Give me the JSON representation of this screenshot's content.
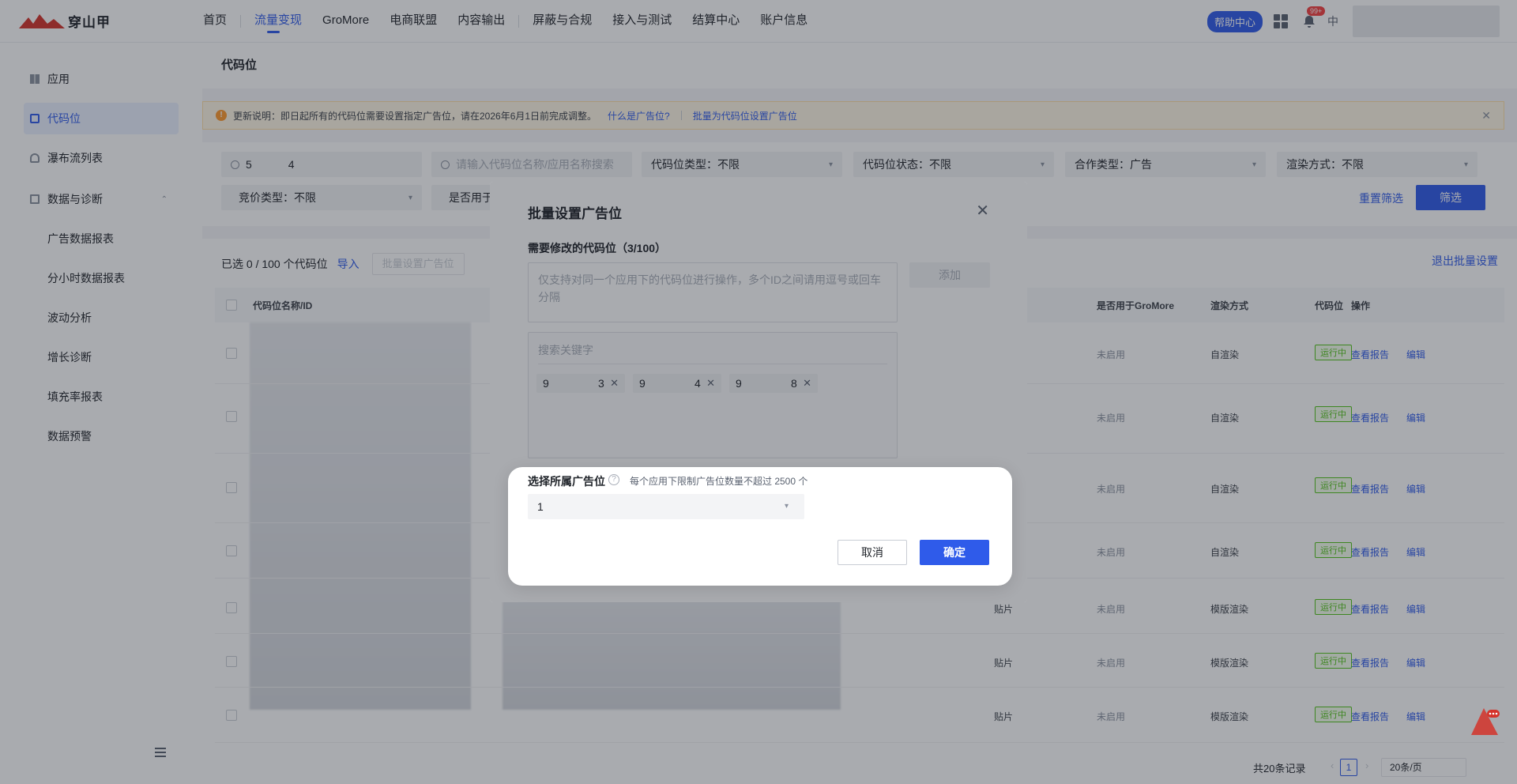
{
  "brand": {
    "name": "穿山甲"
  },
  "topnav": {
    "items": [
      {
        "label": "首页"
      },
      {
        "label": "流量变现"
      },
      {
        "label": "GroMore"
      },
      {
        "label": "电商联盟"
      },
      {
        "label": "内容输出"
      },
      {
        "label": "屏蔽与合规"
      },
      {
        "label": "接入与测试"
      },
      {
        "label": "结算中心"
      },
      {
        "label": "账户信息"
      }
    ],
    "help_label": "帮助中心",
    "notif_badge": "99+",
    "lang": "中"
  },
  "sidebar": {
    "items": [
      {
        "label": "应用"
      },
      {
        "label": "代码位"
      },
      {
        "label": "瀑布流列表"
      },
      {
        "label": "数据与诊断"
      }
    ],
    "sub_items": [
      {
        "label": "广告数据报表"
      },
      {
        "label": "分小时数据报表"
      },
      {
        "label": "波动分析"
      },
      {
        "label": "增长诊断"
      },
      {
        "label": "填充率报表"
      },
      {
        "label": "数据预警"
      }
    ]
  },
  "page": {
    "title": "代码位"
  },
  "notice": {
    "text": "更新说明：即日起所有的代码位需要设置指定广告位，请在2026年6月1日前完成调整。",
    "link1": "什么是广告位?",
    "link2": "批量为代码位设置广告位"
  },
  "filters": {
    "search_prefix": "5",
    "search_suffix": "4",
    "name_placeholder": "请输入代码位名称/应用名称搜索",
    "type": "代码位类型：不限",
    "status": "代码位状态：不限",
    "coop": "合作类型：广告",
    "render": "渲染方式：不限",
    "bid": "竞价类型：不限",
    "gromore": "是否用于",
    "reset": "重置筛选",
    "submit": "筛选"
  },
  "table": {
    "selected_text": "已选 0 / 100 个代码位",
    "import": "导入",
    "batch_btn": "批量设置广告位",
    "exit_batch": "退出批量设置",
    "headers": {
      "name": "代码位名称/ID",
      "gromore": "是否用于GroMore",
      "render": "渲染方式",
      "status": "代码位",
      "ops": "操作"
    },
    "rows": [
      {
        "type": "",
        "gromore": "未启用",
        "render": "自渲染",
        "status": "运行中",
        "report": "查看报告",
        "edit": "编辑"
      },
      {
        "type": "",
        "gromore": "未启用",
        "render": "自渲染",
        "status": "运行中",
        "report": "查看报告",
        "edit": "编辑"
      },
      {
        "type": "",
        "gromore": "未启用",
        "render": "自渲染",
        "status": "运行中",
        "report": "查看报告",
        "edit": "编辑"
      },
      {
        "type": "",
        "gromore": "未启用",
        "render": "自渲染",
        "status": "运行中",
        "report": "查看报告",
        "edit": "编辑"
      },
      {
        "type": "贴片",
        "gromore": "未启用",
        "render": "模版渲染",
        "status": "运行中",
        "report": "查看报告",
        "edit": "编辑"
      },
      {
        "type": "贴片",
        "gromore": "未启用",
        "render": "模版渲染",
        "status": "运行中",
        "report": "查看报告",
        "edit": "编辑"
      },
      {
        "type": "贴片",
        "gromore": "未启用",
        "render": "模版渲染",
        "status": "运行中",
        "report": "查看报告",
        "edit": "编辑"
      }
    ],
    "total": "共20条记录",
    "current_page": "1",
    "page_size": "20条/页"
  },
  "modal": {
    "title": "批量设置广告位",
    "section_label": "需要修改的代码位（3/100）",
    "textarea_placeholder": "仅支持对同一个应用下的代码位进行操作，多个ID之间请用逗号或回车分隔",
    "add_label": "添加",
    "search_placeholder": "搜索关键字",
    "tags": [
      {
        "start": "9",
        "end": "3"
      },
      {
        "start": "9",
        "end": "4"
      },
      {
        "start": "9",
        "end": "8"
      }
    ],
    "select_label": "选择所属广告位",
    "select_hint": "每个应用下限制广告位数量不超过 2500 个",
    "select_value": "1",
    "cancel": "取消",
    "confirm": "确定"
  },
  "colors": {
    "primary": "#2f5bea",
    "success": "#52c41a",
    "warning": "#ff9a2e"
  }
}
